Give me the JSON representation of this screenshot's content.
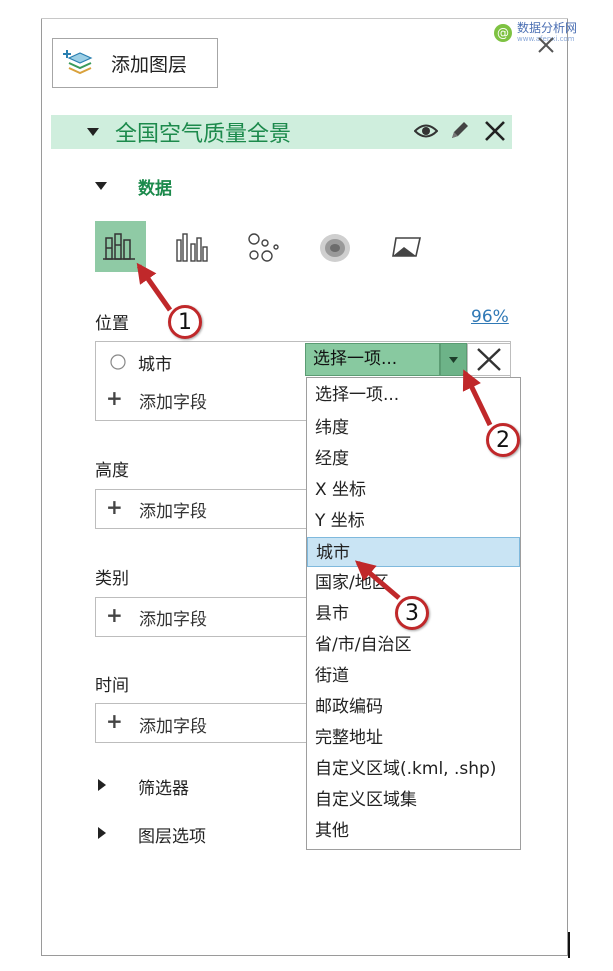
{
  "add_layer": {
    "label": "添加图层"
  },
  "layer": {
    "title": "全国空气质量全景"
  },
  "data_section": {
    "label": "数据"
  },
  "location": {
    "label": "位置",
    "percent": "96%",
    "field_city": "城市",
    "add_field": "添加字段"
  },
  "select": {
    "value": "选择一项..."
  },
  "height": {
    "label": "高度",
    "add_field": "添加字段"
  },
  "category": {
    "label": "类别",
    "add_field": "添加字段"
  },
  "time": {
    "label": "时间",
    "add_field": "添加字段"
  },
  "filters": {
    "label": "筛选器"
  },
  "layer_options": {
    "label": "图层选项"
  },
  "dropdown": {
    "items": [
      "选择一项...",
      "纬度",
      "经度",
      "X 坐标",
      "Y 坐标",
      "城市",
      "国家/地区",
      "县市",
      "省/市/自治区",
      "街道",
      "邮政编码",
      "完整地址",
      "自定义区域(.kml, .shp)",
      "自定义区域集",
      "其他"
    ],
    "highlighted": "城市"
  },
  "callouts": [
    "1",
    "2",
    "3"
  ],
  "watermark": {
    "text": "数据分析网",
    "sub": "www.afenxi.com"
  },
  "colors": {
    "accent_green": "#1c8a4c",
    "layer_bar": "#cfeedd",
    "select_bg": "#88c9a0",
    "callout_red": "#c0282a",
    "highlight": "#c9e4f4",
    "percent_link": "#2f78b5"
  }
}
